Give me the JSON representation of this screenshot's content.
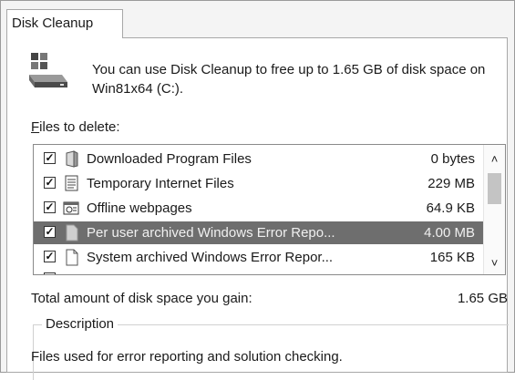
{
  "window": {
    "tab_label": "Disk Cleanup"
  },
  "intro": {
    "text": "You can use Disk Cleanup to free up to 1.65 GB of disk space on Win81x64 (C:).",
    "icon": "hard-drive-icon"
  },
  "files": {
    "label_accel": "F",
    "label_rest": "iles to delete:",
    "items": [
      {
        "name": "Downloaded Program Files",
        "size": "0 bytes",
        "checked": true,
        "icon": "folder-icon",
        "selected": false
      },
      {
        "name": "Temporary Internet Files",
        "size": "229 MB",
        "checked": true,
        "icon": "text-document-icon",
        "selected": false
      },
      {
        "name": "Offline webpages",
        "size": "64.9 KB",
        "checked": true,
        "icon": "webpage-icon",
        "selected": false
      },
      {
        "name": "Per user archived Windows Error Repo...",
        "size": "4.00 MB",
        "checked": true,
        "icon": "blank-document-icon",
        "selected": true
      },
      {
        "name": "System archived Windows Error Repor...",
        "size": "165 KB",
        "checked": true,
        "icon": "blank-document-icon",
        "selected": false
      }
    ],
    "scroll_up": "^",
    "scroll_down": "v"
  },
  "total": {
    "label": "Total amount of disk space you gain:",
    "value": "1.65 GB"
  },
  "description": {
    "legend": "Description",
    "text": "Files used for error reporting and solution checking."
  },
  "colors": {
    "selection": "#6e6e6e",
    "border": "#a8a8a8"
  }
}
